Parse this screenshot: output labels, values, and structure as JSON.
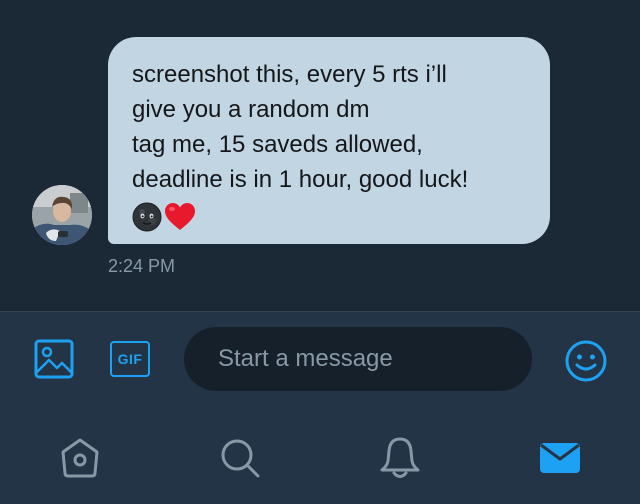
{
  "conversation": {
    "message": {
      "lines": [
        "screenshot this, every 5 rts i’ll",
        "give you a random dm",
        "tag me, 15 saveds allowed,",
        "deadline is in 1 hour, good luck!"
      ],
      "emojis": [
        "new-moon-face-emoji",
        "red-heart-emoji"
      ],
      "timestamp": "2:24 PM"
    }
  },
  "composer": {
    "gif_label": "GIF",
    "placeholder": "Start a message",
    "icons": [
      "image-icon",
      "gif-icon",
      "emoji-icon"
    ]
  },
  "tabbar": {
    "tabs": [
      {
        "name": "home",
        "icon": "home-icon",
        "active": false
      },
      {
        "name": "search",
        "icon": "search-icon",
        "active": false
      },
      {
        "name": "notifications",
        "icon": "bell-icon",
        "active": false
      },
      {
        "name": "messages",
        "icon": "envelope-icon",
        "active": true
      }
    ]
  },
  "colors": {
    "background": "#1b2836",
    "bar": "#243447",
    "bubble": "#c2d5e3",
    "accent": "#1da1f2",
    "muted": "#8899a6",
    "input": "#15202b"
  }
}
